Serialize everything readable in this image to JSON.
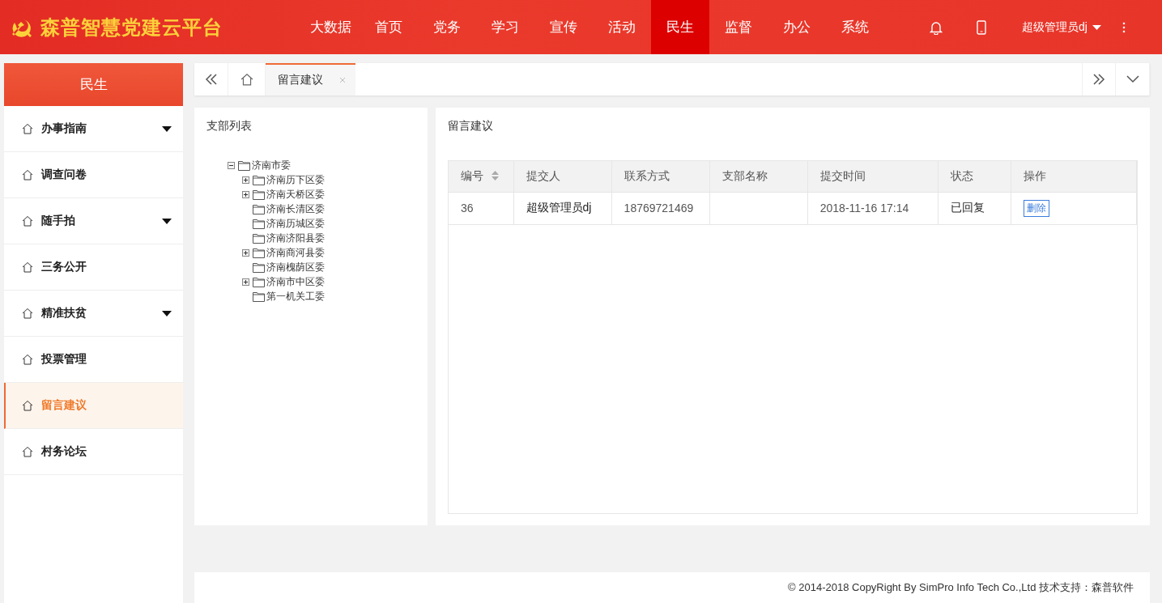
{
  "header": {
    "title": "森普智慧党建云平台",
    "nav": [
      {
        "label": "大数据",
        "selected": false
      },
      {
        "label": "首页",
        "selected": false
      },
      {
        "label": "党务",
        "selected": false
      },
      {
        "label": "学习",
        "selected": false
      },
      {
        "label": "宣传",
        "selected": false
      },
      {
        "label": "活动",
        "selected": false
      },
      {
        "label": "民生",
        "selected": true
      },
      {
        "label": "监督",
        "selected": false
      },
      {
        "label": "办公",
        "selected": false
      },
      {
        "label": "系统",
        "selected": false
      }
    ],
    "user": "超级管理员dj"
  },
  "sidebar": {
    "title": "民生",
    "items": [
      {
        "label": "办事指南",
        "has_submenu": true,
        "selected": false
      },
      {
        "label": "调查问卷",
        "has_submenu": false,
        "selected": false
      },
      {
        "label": "随手拍",
        "has_submenu": true,
        "selected": false
      },
      {
        "label": "三务公开",
        "has_submenu": false,
        "selected": false
      },
      {
        "label": "精准扶贫",
        "has_submenu": true,
        "selected": false
      },
      {
        "label": "投票管理",
        "has_submenu": false,
        "selected": false
      },
      {
        "label": "留言建议",
        "has_submenu": false,
        "selected": true
      },
      {
        "label": "村务论坛",
        "has_submenu": false,
        "selected": false
      }
    ]
  },
  "tabs": [
    {
      "label": "留言建议",
      "selected": true
    }
  ],
  "tree_panel": {
    "title": "支部列表",
    "tree": [
      {
        "label": "济南市委",
        "kind": "branch",
        "expanded": true,
        "children": [
          {
            "label": "济南历下区委",
            "kind": "branch",
            "expanded": false
          },
          {
            "label": "济南天桥区委",
            "kind": "branch",
            "expanded": false
          },
          {
            "label": "济南长清区委",
            "kind": "leaf"
          },
          {
            "label": "济南历城区委",
            "kind": "leaf"
          },
          {
            "label": "济南济阳县委",
            "kind": "leaf"
          },
          {
            "label": "济南商河县委",
            "kind": "branch",
            "expanded": false
          },
          {
            "label": "济南槐荫区委",
            "kind": "leaf"
          },
          {
            "label": "济南市中区委",
            "kind": "branch",
            "expanded": false
          },
          {
            "label": "第一机关工委",
            "kind": "leaf"
          }
        ]
      }
    ]
  },
  "table_panel": {
    "title": "留言建议",
    "columns": [
      {
        "label": "编号",
        "sortable": true
      },
      {
        "label": "提交人",
        "sortable": false
      },
      {
        "label": "联系方式",
        "sortable": false
      },
      {
        "label": "支部名称",
        "sortable": false
      },
      {
        "label": "提交时间",
        "sortable": false
      },
      {
        "label": "状态",
        "sortable": false
      },
      {
        "label": "操作",
        "sortable": false
      }
    ],
    "rows": [
      {
        "cells": [
          "36",
          "超级管理员dj",
          "18769721469",
          "",
          "2018-11-16 17:14",
          "已回复"
        ],
        "action": "删除"
      }
    ]
  },
  "footer": "© 2014-2018 CopyRight By SimPro Info Tech Co.,Ltd 技术支持：森普软件"
}
